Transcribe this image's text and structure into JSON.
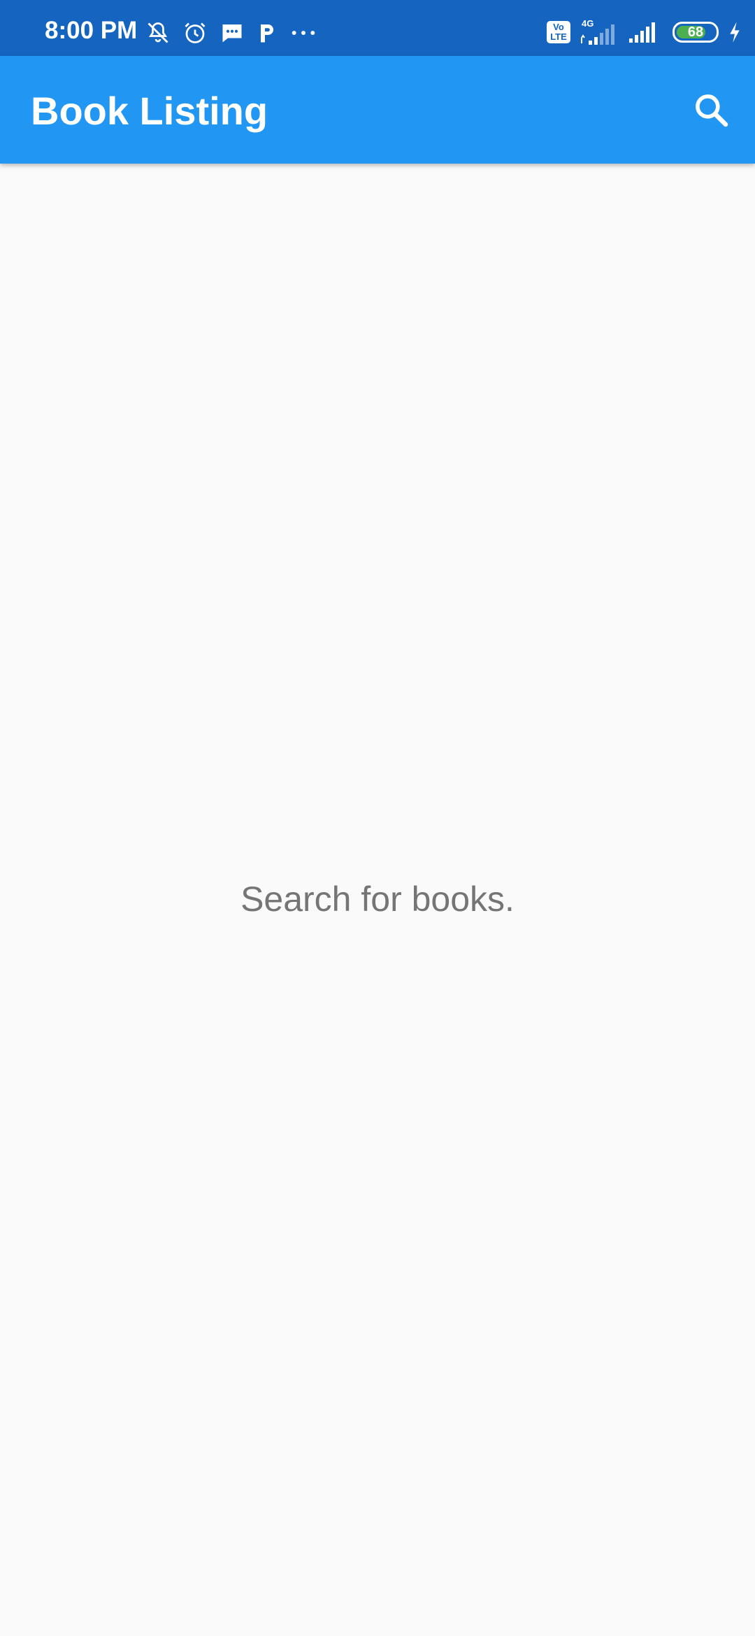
{
  "status_bar": {
    "time": "8:00 PM",
    "volte_label": "Vo LTE",
    "network_type": "4G",
    "battery_level": "68",
    "left_icons": [
      "muted-bell-icon",
      "alarm-icon",
      "message-icon",
      "parking-app-icon",
      "more-dots-icon"
    ],
    "right_icons": [
      "volte-icon",
      "signal-4g-icon",
      "signal-icon",
      "battery-icon",
      "charging-icon"
    ]
  },
  "app_bar": {
    "title": "Book Listing",
    "action_icon": "search-icon"
  },
  "main": {
    "empty_message": "Search for books."
  },
  "colors": {
    "status_bar": "#1565c0",
    "app_bar": "#2196f3",
    "background": "#fafafa",
    "empty_text": "#757575",
    "battery_fill": "#4caf50"
  }
}
